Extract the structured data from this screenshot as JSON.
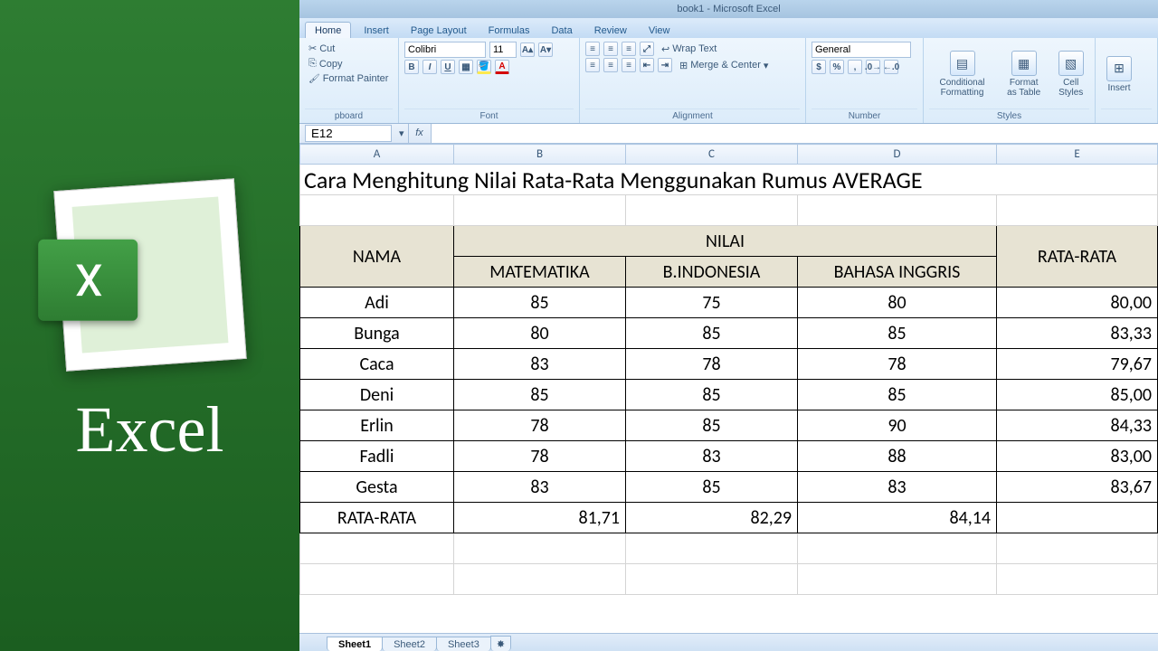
{
  "overlay_caption": "Excel",
  "title_bar": "book1 - Microsoft Excel",
  "ribbon_tabs": [
    "Home",
    "Insert",
    "Page Layout",
    "Formulas",
    "Data",
    "Review",
    "View"
  ],
  "active_tab": "Home",
  "clipboard": {
    "cut": "Cut",
    "copy": "Copy",
    "format_painter": "Format Painter",
    "label": "pboard"
  },
  "font": {
    "name": "Colibri",
    "size": "11",
    "label": "Font"
  },
  "alignment": {
    "wrap": "Wrap Text",
    "merge": "Merge & Center",
    "label": "Alignment"
  },
  "number": {
    "format": "General",
    "label": "Number"
  },
  "styles": {
    "cond": "Conditional Formatting",
    "fmt": "Format as Table",
    "cell": "Cell Styles",
    "label": "Styles"
  },
  "cells": {
    "insert": "Insert"
  },
  "formula_bar": {
    "name_box": "E12",
    "fx": "fx",
    "formula": ""
  },
  "columns": [
    "A",
    "B",
    "C",
    "D",
    "E"
  ],
  "sheet": {
    "title": "Cara Menghitung Nilai Rata-Rata Menggunakan Rumus AVERAGE",
    "header_nama": "NAMA",
    "header_nilai": "NILAI",
    "header_rata": "RATA-RATA",
    "sub_mat": "MATEMATIKA",
    "sub_ind": "B.INDONESIA",
    "sub_eng": "BAHASA INGGRIS",
    "rows": [
      {
        "n": "Adi",
        "m": "85",
        "i": "75",
        "e": "80",
        "r": "80,00"
      },
      {
        "n": "Bunga",
        "m": "80",
        "i": "85",
        "e": "85",
        "r": "83,33"
      },
      {
        "n": "Caca",
        "m": "83",
        "i": "78",
        "e": "78",
        "r": "79,67"
      },
      {
        "n": "Deni",
        "m": "85",
        "i": "85",
        "e": "85",
        "r": "85,00"
      },
      {
        "n": "Erlin",
        "m": "78",
        "i": "85",
        "e": "90",
        "r": "84,33"
      },
      {
        "n": "Fadli",
        "m": "78",
        "i": "83",
        "e": "88",
        "r": "83,00"
      },
      {
        "n": "Gesta",
        "m": "83",
        "i": "85",
        "e": "83",
        "r": "83,67"
      }
    ],
    "footer": {
      "n": "RATA-RATA",
      "m": "81,71",
      "i": "82,29",
      "e": "84,14",
      "r": ""
    }
  },
  "sheet_tabs": [
    "Sheet1",
    "Sheet2",
    "Sheet3"
  ],
  "active_sheet": "Sheet1"
}
